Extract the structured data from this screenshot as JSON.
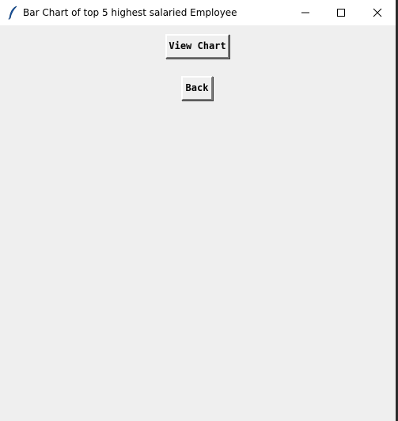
{
  "window": {
    "title": "Bar Chart of top 5 highest salaried Employee",
    "icon": "feather-icon"
  },
  "controls": {
    "minimize": "minimize-icon",
    "maximize": "maximize-icon",
    "close": "close-icon"
  },
  "buttons": {
    "view_chart_label": "View Chart",
    "back_label": "Back"
  }
}
